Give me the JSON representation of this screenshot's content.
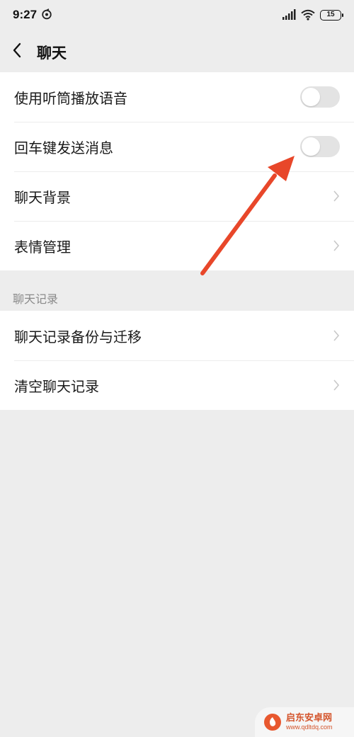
{
  "status_bar": {
    "time": "9:27",
    "battery": "15",
    "icons": [
      "camera-app-icon",
      "signal-icon",
      "wifi-icon",
      "battery-icon"
    ]
  },
  "nav": {
    "title": "聊天",
    "back_icon": "chevron-left-icon"
  },
  "settings_group_1": [
    {
      "label": "使用听筒播放语音",
      "type": "toggle",
      "enabled": false
    },
    {
      "label": "回车键发送消息",
      "type": "toggle",
      "enabled": false
    },
    {
      "label": "聊天背景",
      "type": "link"
    },
    {
      "label": "表情管理",
      "type": "link"
    }
  ],
  "chat_history_section": {
    "header": "聊天记录",
    "items": [
      {
        "label": "聊天记录备份与迁移",
        "type": "link"
      },
      {
        "label": "清空聊天记录",
        "type": "link"
      }
    ]
  },
  "annotation": {
    "color": "#e8472a",
    "target": "回车键发送消息"
  },
  "watermark": {
    "name": "启东安卓网",
    "url": "www.qdltdq.com"
  },
  "colors": {
    "background": "#ededed",
    "card": "#ffffff",
    "toggle_off": "#e3e3e3",
    "section_header_text": "#8a8a8a",
    "text": "#1a1a1a"
  }
}
